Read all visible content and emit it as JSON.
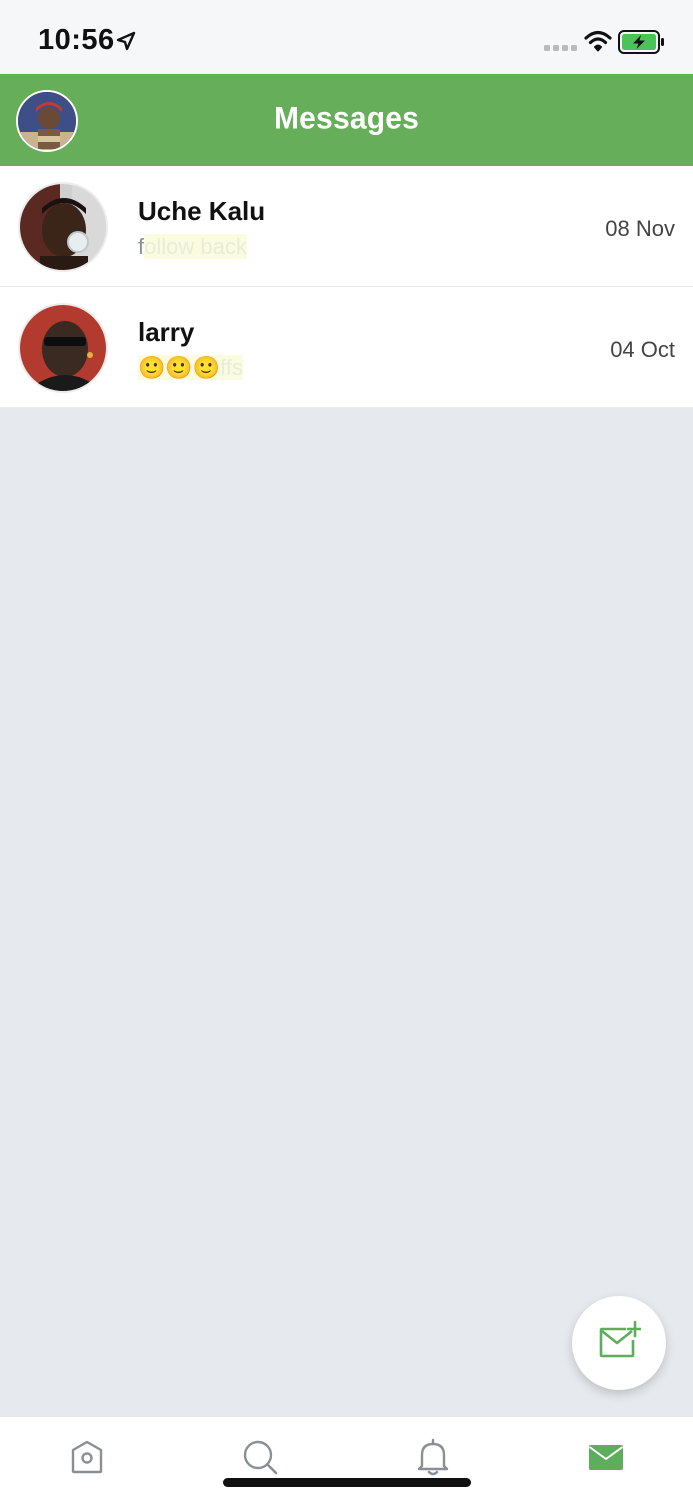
{
  "status_bar": {
    "time": "10:56",
    "icons": [
      "location-arrow-icon",
      "signal-dots-icon",
      "wifi-icon",
      "battery-charging-icon"
    ]
  },
  "header": {
    "title": "Messages",
    "color": "#66ae5a"
  },
  "conversations": [
    {
      "name": "Uche Kalu",
      "preview_lead": "f",
      "preview_rest": "ollow back",
      "date": "08 Nov"
    },
    {
      "name": "larry",
      "preview_lead": "",
      "preview_rest": "🙂🙂🙂ffs",
      "date": "04 Oct"
    }
  ],
  "fab": {
    "icon": "new-message-icon"
  },
  "tabbar": {
    "tabs": [
      {
        "icon": "home-icon",
        "active": false
      },
      {
        "icon": "search-icon",
        "active": false
      },
      {
        "icon": "bell-icon",
        "active": false
      },
      {
        "icon": "mail-icon",
        "active": true
      }
    ],
    "active_color": "#5cae5c",
    "inactive_color": "#8a8f95"
  }
}
